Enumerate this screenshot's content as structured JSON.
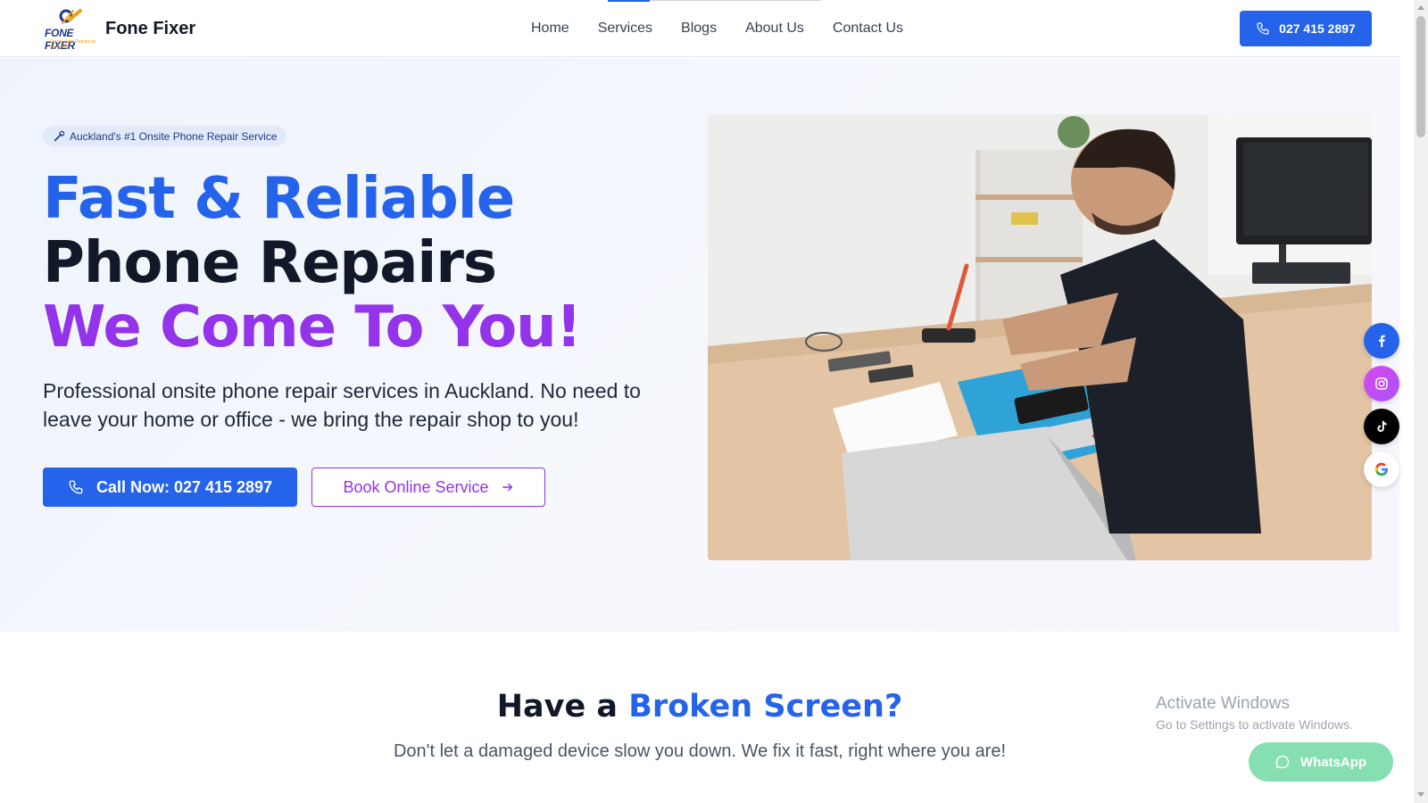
{
  "header": {
    "brand": "Fone Fixer",
    "logo_text": "FONE FIXER",
    "logo_tagline": "On the Spot Repairs at the Home",
    "nav": [
      "Home",
      "Services",
      "Blogs",
      "About Us",
      "Contact Us"
    ],
    "active_nav": "Services",
    "phone": "027 415 2897"
  },
  "hero": {
    "badge": "Auckland's #1 Onsite Phone Repair Service",
    "title_line1": "Fast & Reliable",
    "title_line2": "Phone Repairs",
    "title_line3": "We Come To You!",
    "lead": "Professional onsite phone repair services in Auckland. No need to leave your home or office - we bring the repair shop to you!",
    "primary_button": "Call Now: 027 415 2897",
    "secondary_button": "Book Online Service",
    "image_icon": "technician-repairing-phone-photo"
  },
  "social": [
    {
      "name": "facebook",
      "icon": "facebook-icon",
      "color": "#2563eb"
    },
    {
      "name": "instagram",
      "icon": "instagram-icon",
      "color": "#c13fb0"
    },
    {
      "name": "tiktok",
      "icon": "tiktok-icon",
      "color": "#000000"
    },
    {
      "name": "google",
      "icon": "google-icon",
      "color": "#ffffff"
    }
  ],
  "section2": {
    "title_prefix": "Have a ",
    "title_highlight": "Broken Screen?",
    "subtitle": "Don't let a damaged device slow you down. We fix it fast, right where you are!"
  },
  "windows_watermark": {
    "line1": "Activate Windows",
    "line2": "Go to Settings to activate Windows."
  },
  "whatsapp": {
    "label": "WhatsApp"
  },
  "colors": {
    "primary": "#2563eb",
    "purple": "#9333ea",
    "dark": "#111827",
    "whatsapp": "#86dfb0"
  }
}
